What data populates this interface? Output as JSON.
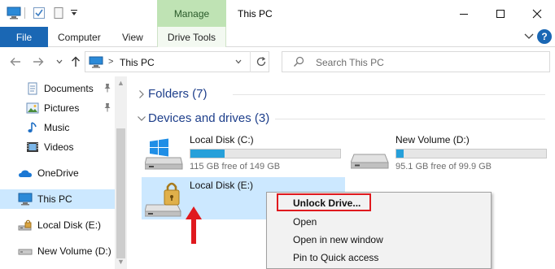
{
  "window": {
    "title": "This PC",
    "contextual_tab_group": "Manage",
    "controls": {
      "minimize": "minimize",
      "maximize": "maximize",
      "close": "close"
    }
  },
  "ribbon": {
    "tabs": [
      {
        "label": "File"
      },
      {
        "label": "Computer"
      },
      {
        "label": "View"
      },
      {
        "label": "Drive Tools"
      }
    ],
    "help_label": "?"
  },
  "address_bar": {
    "path_root_icon": "this-pc-icon",
    "separator": ">",
    "path": "This PC",
    "search_placeholder": "Search This PC"
  },
  "nav_pane": {
    "items": [
      {
        "label": "Documents",
        "icon": "documents-icon",
        "pinned": true
      },
      {
        "label": "Pictures",
        "icon": "pictures-icon",
        "pinned": true
      },
      {
        "label": "Music",
        "icon": "music-icon",
        "pinned": false
      },
      {
        "label": "Videos",
        "icon": "videos-icon",
        "pinned": false
      },
      {
        "label": "OneDrive",
        "icon": "onedrive-icon",
        "pinned": false
      },
      {
        "label": "This PC",
        "icon": "this-pc-icon",
        "pinned": false,
        "selected": true
      },
      {
        "label": "Local Disk (E:)",
        "icon": "locked-drive-icon",
        "pinned": false
      },
      {
        "label": "New Volume (D:)",
        "icon": "drive-icon",
        "pinned": false
      }
    ]
  },
  "content": {
    "groups": [
      {
        "title": "Folders (7)",
        "expanded": false
      },
      {
        "title": "Devices and drives (3)",
        "expanded": true
      }
    ],
    "drives": [
      {
        "name": "Local Disk (C:)",
        "free_text": "115 GB free of 149 GB",
        "used_fraction": 0.23,
        "icon": "windows-drive-icon"
      },
      {
        "name": "New Volume (D:)",
        "free_text": "95.1 GB free of 99.9 GB",
        "used_fraction": 0.05,
        "icon": "drive-icon"
      },
      {
        "name": "Local Disk (E:)",
        "free_text": "",
        "used_fraction": null,
        "icon": "locked-drive-icon",
        "selected": true
      }
    ]
  },
  "context_menu": {
    "items": [
      {
        "label": "Unlock Drive...",
        "highlighted": true
      },
      {
        "label": "Open"
      },
      {
        "label": "Open in new window"
      },
      {
        "label": "Pin to Quick access"
      }
    ]
  },
  "colors": {
    "file_tab": "#1a67b4",
    "manage_tab": "#bfe3b4",
    "selection": "#cce8ff",
    "capacity_bar": "#26a0da",
    "group_title": "#1e3f8b",
    "annotation_red": "#e0191e"
  }
}
